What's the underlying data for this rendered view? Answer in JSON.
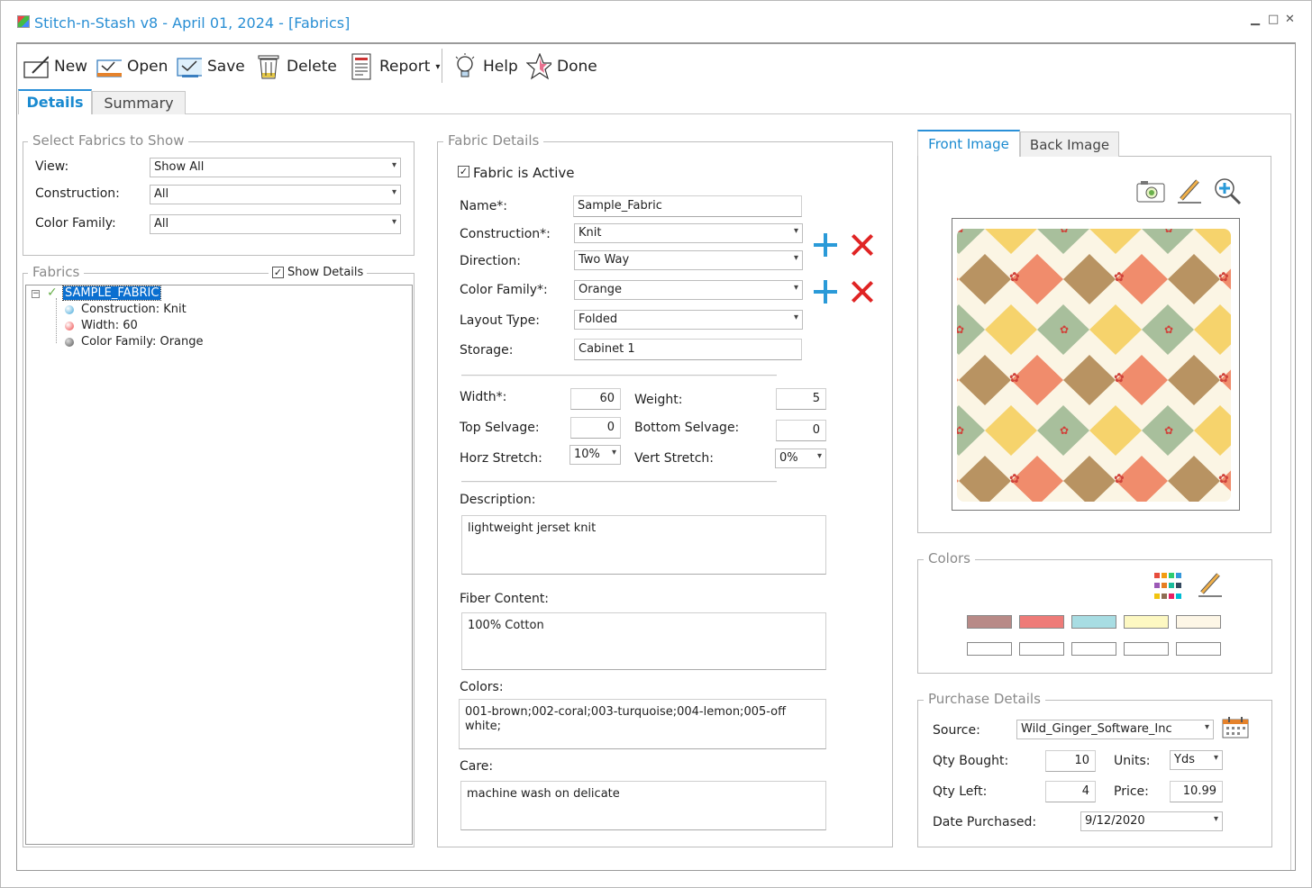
{
  "window": {
    "title": "Stitch-n-Stash v8 - April 01, 2024 - [Fabrics]",
    "minimize": "▫",
    "maximize": "▫",
    "close": "✕"
  },
  "toolbar": {
    "new": "New",
    "open": "Open",
    "save": "Save",
    "delete": "Delete",
    "report": "Report",
    "help": "Help",
    "done": "Done"
  },
  "tabs": {
    "details": "Details",
    "summary": "Summary"
  },
  "select_fabrics": {
    "title": "Select Fabrics to Show",
    "view_label": "View:",
    "view_value": "Show All",
    "construction_label": "Construction:",
    "construction_value": "All",
    "color_family_label": "Color Family:",
    "color_family_value": "All"
  },
  "fabrics_list": {
    "title": "Fabrics",
    "show_details": "Show Details",
    "root": "SAMPLE_FABRIC",
    "children": [
      "Construction: Knit",
      "Width: 60",
      "Color Family: Orange"
    ]
  },
  "fabric_details": {
    "title": "Fabric Details",
    "active_label": "Fabric is Active",
    "name_label": "Name*:",
    "name_value": "Sample_Fabric",
    "construction_label": "Construction*:",
    "construction_value": "Knit",
    "direction_label": "Direction:",
    "direction_value": "Two Way",
    "color_family_label": "Color Family*:",
    "color_family_value": "Orange",
    "layout_label": "Layout Type:",
    "layout_value": "Folded",
    "storage_label": "Storage:",
    "storage_value": "Cabinet 1",
    "width_label": "Width*:",
    "width_value": "60",
    "weight_label": "Weight:",
    "weight_value": "5",
    "top_selvage_label": "Top Selvage:",
    "top_selvage_value": "0",
    "bottom_selvage_label": "Bottom Selvage:",
    "bottom_selvage_value": "0",
    "horz_stretch_label": "Horz Stretch:",
    "horz_stretch_value": "10%",
    "vert_stretch_label": "Vert Stretch:",
    "vert_stretch_value": "0%",
    "description_label": "Description:",
    "description_value": "lightweight jerset knit",
    "fiber_label": "Fiber Content:",
    "fiber_value": "100% Cotton",
    "colors_label": "Colors:",
    "colors_value": "001-brown;002-coral;003-turquoise;004-lemon;005-off white;",
    "care_label": "Care:",
    "care_value": "machine wash on delicate"
  },
  "image_tabs": {
    "front": "Front Image",
    "back": "Back Image"
  },
  "colors_panel": {
    "title": "Colors",
    "swatches": [
      "#b88a87",
      "#ee7b78",
      "#a8dde3",
      "#fdf8c2",
      "#fdf6e6",
      "#ffffff",
      "#ffffff",
      "#ffffff",
      "#ffffff",
      "#ffffff"
    ]
  },
  "purchase": {
    "title": "Purchase Details",
    "source_label": "Source:",
    "source_value": "Wild_Ginger_Software_Inc",
    "qty_bought_label": "Qty Bought:",
    "qty_bought_value": "10",
    "units_label": "Units:",
    "units_value": "Yds",
    "qty_left_label": "Qty Left:",
    "qty_left_value": "4",
    "price_label": "Price:",
    "price_value": "10.99",
    "date_label": "Date Purchased:",
    "date_value": "9/12/2020"
  },
  "colors": {
    "accent": "#2a90d8",
    "delete": "#e02424",
    "selection": "#0a6fd0"
  }
}
